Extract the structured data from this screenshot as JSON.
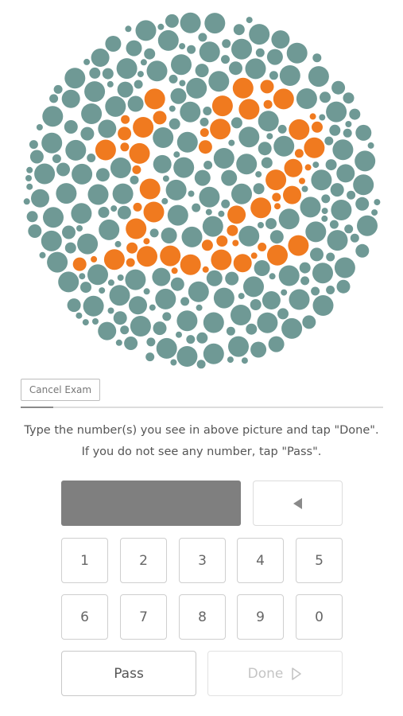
{
  "plate": {
    "hidden_number": "12",
    "background_dot_color": "#6f9995",
    "number_dot_color": "#f07a1f"
  },
  "cancel_label": "Cancel Exam",
  "progress": {
    "fraction": 0.09
  },
  "instructions": {
    "line1": "Type the number(s) you see in above picture and tap \"Done\".",
    "line2": "If you do not see any number, tap \"Pass\"."
  },
  "answer": {
    "value": ""
  },
  "keypad": {
    "keys": [
      "1",
      "2",
      "3",
      "4",
      "5",
      "6",
      "7",
      "8",
      "9",
      "0"
    ],
    "backspace_icon": "backspace-triangle-icon"
  },
  "pass_label": "Pass",
  "done_label": "Done",
  "done_icon": "play-outline-icon"
}
